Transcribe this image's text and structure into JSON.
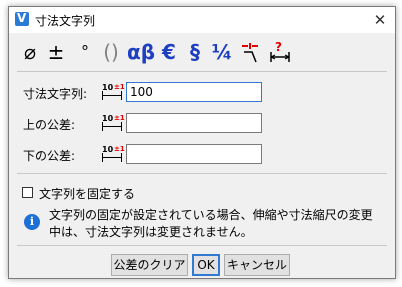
{
  "window": {
    "title": "寸法文字列",
    "close_glyph": "✕"
  },
  "toolbar": {
    "buttons": [
      {
        "name": "diameter",
        "glyph": "⌀",
        "color": "#000000"
      },
      {
        "name": "plus-minus",
        "glyph": "±",
        "color": "#000000"
      },
      {
        "name": "degree",
        "glyph": "°",
        "color": "#000000"
      },
      {
        "name": "parentheses",
        "glyph": "()",
        "color": "#808080"
      },
      {
        "name": "alpha-beta",
        "glyph": "αβ",
        "color": "#1e3fbf"
      },
      {
        "name": "euro",
        "glyph": "€",
        "color": "#1e3fbf"
      },
      {
        "name": "section",
        "glyph": "§",
        "color": "#1e3fbf"
      },
      {
        "name": "quarter",
        "glyph": "¼",
        "color": "#1e3fbf"
      }
    ]
  },
  "fields": {
    "dimension_text": {
      "label": "寸法文字列:",
      "value": "100"
    },
    "upper_tolerance": {
      "label": "上の公差:",
      "value": ""
    },
    "lower_tolerance": {
      "label": "下の公差:",
      "value": ""
    }
  },
  "icon_label": {
    "number": "10",
    "tol": "±1"
  },
  "fix_text": {
    "label": "文字列を固定する",
    "checked": false
  },
  "info": {
    "line1": "文字列の固定が設定されている場合、伸縮や寸法縮尺の変更",
    "line2": "中は、寸法文字列は変更されません。"
  },
  "buttons": {
    "clear_tolerance": "公差のクリア",
    "ok": "OK",
    "cancel": "キャンセル"
  }
}
